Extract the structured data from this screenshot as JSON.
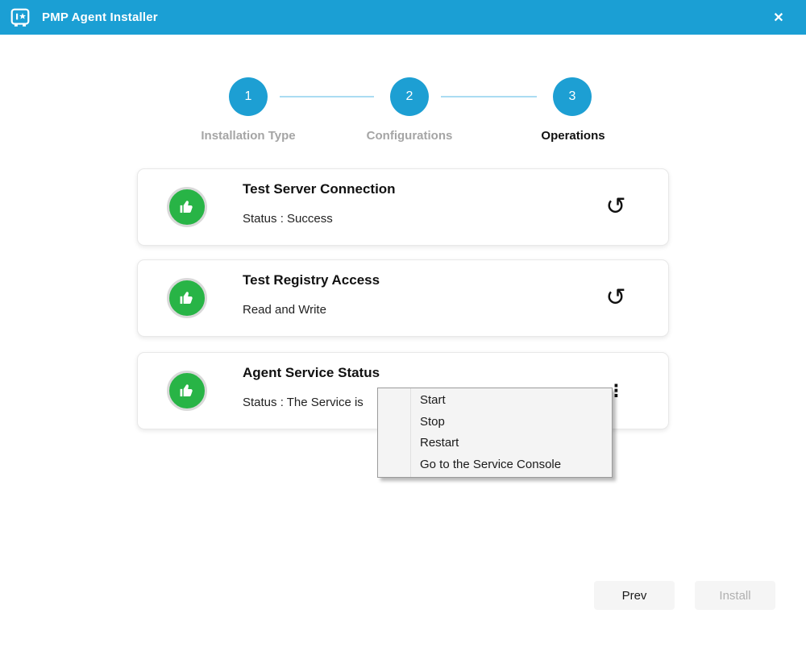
{
  "titlebar": {
    "title": "PMP Agent Installer",
    "app_icon": "vault-icon",
    "close_glyph": "✕"
  },
  "stepper": {
    "steps": [
      {
        "number": "1",
        "label": "Installation Type",
        "active": false
      },
      {
        "number": "2",
        "label": "Configurations",
        "active": false
      },
      {
        "number": "3",
        "label": "Operations",
        "active": true
      }
    ]
  },
  "cards": [
    {
      "title": "Test Server Connection",
      "subtitle": "Status : Success",
      "status_icon": "thumbs-up-icon",
      "action_icon": "refresh-icon",
      "action_glyph": "↺"
    },
    {
      "title": "Test Registry Access",
      "subtitle": "Read and Write",
      "status_icon": "thumbs-up-icon",
      "action_icon": "refresh-icon",
      "action_glyph": "↺"
    },
    {
      "title": "Agent Service Status",
      "subtitle": "Status : The Service is",
      "status_icon": "thumbs-up-icon",
      "action_icon": "kebab-menu-icon",
      "action_glyph": "⋮"
    }
  ],
  "context_menu": {
    "items": [
      "Start",
      "Stop",
      "Restart",
      "Go to the Service Console"
    ]
  },
  "footer": {
    "prev_label": "Prev",
    "install_label": "Install",
    "install_enabled": false
  },
  "colors": {
    "titlebar": "#1b9fd4",
    "accent": "#1d9fd3",
    "connector": "#abdcf2",
    "success_green": "#28b446",
    "inactive_label": "#a5a5a5",
    "active_label": "#111111",
    "menu_bg": "#f4f4f4",
    "button_bg": "#f5f5f5",
    "disabled_text": "#b0b0b0"
  }
}
